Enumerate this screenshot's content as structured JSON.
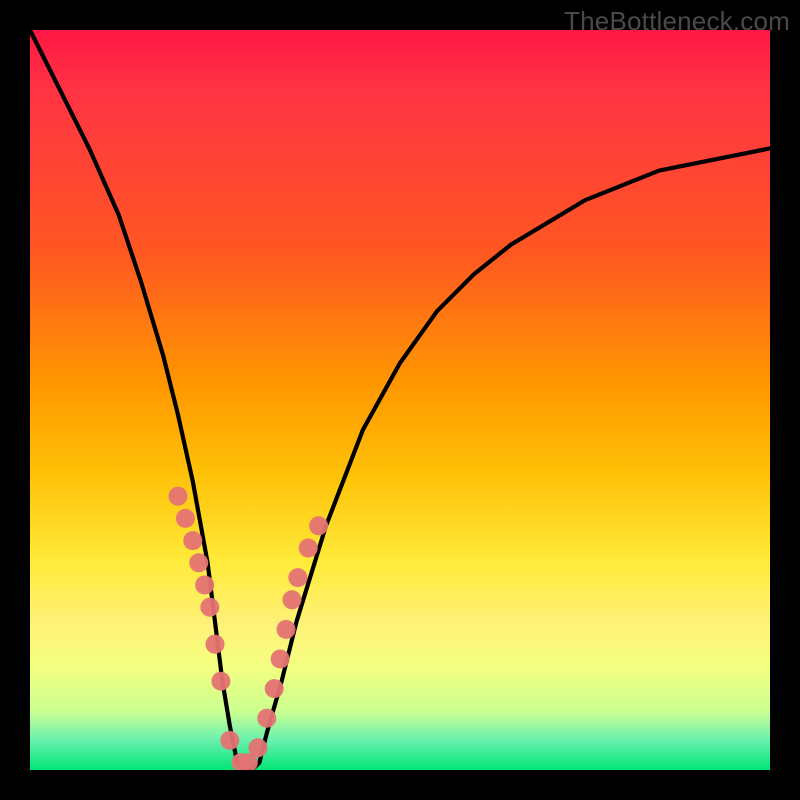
{
  "watermark": "TheBottleneck.com",
  "chart_data": {
    "type": "line",
    "title": "",
    "xlabel": "",
    "ylabel": "",
    "xlim": [
      0,
      100
    ],
    "ylim": [
      0,
      100
    ],
    "curve": {
      "name": "bottleneck-curve",
      "x": [
        0,
        4,
        8,
        12,
        15,
        18,
        20,
        22,
        24,
        25,
        26,
        27,
        28,
        29,
        30,
        31,
        32,
        34,
        36,
        40,
        45,
        50,
        55,
        60,
        65,
        70,
        75,
        80,
        85,
        90,
        95,
        100
      ],
      "y": [
        100,
        92,
        84,
        75,
        66,
        56,
        48,
        39,
        28,
        20,
        12,
        6,
        1,
        0,
        0,
        1,
        5,
        12,
        20,
        33,
        46,
        55,
        62,
        67,
        71,
        74,
        77,
        79,
        81,
        82,
        83,
        84
      ]
    },
    "markers": {
      "name": "highlight-points",
      "color": "#e57373",
      "x": [
        20,
        21,
        22,
        22.8,
        23.6,
        24.3,
        25,
        25.8,
        27,
        28.5,
        29.5,
        30.8,
        32,
        33,
        33.8,
        34.6,
        35.4,
        36.2,
        37.6,
        39
      ],
      "y": [
        37,
        34,
        31,
        28,
        25,
        22,
        17,
        12,
        4,
        1,
        1,
        3,
        7,
        11,
        15,
        19,
        23,
        26,
        30,
        33
      ]
    },
    "green_band": {
      "y0": 0,
      "y1": 4
    }
  }
}
